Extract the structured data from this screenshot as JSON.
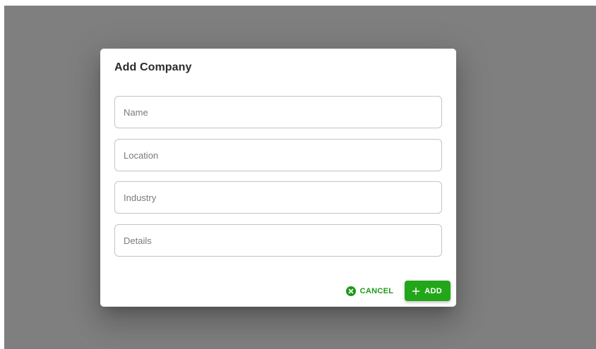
{
  "dialog": {
    "title": "Add Company",
    "fields": [
      {
        "placeholder": "Name",
        "value": ""
      },
      {
        "placeholder": "Location",
        "value": ""
      },
      {
        "placeholder": "Industry",
        "value": ""
      },
      {
        "placeholder": "Details",
        "value": ""
      }
    ],
    "actions": {
      "cancel_label": "CANCEL",
      "cancel_icon": "cancel-circle-icon",
      "add_label": "ADD",
      "add_icon": "plus-icon"
    }
  },
  "colors": {
    "accent": "#22a61a",
    "backdrop": "#7f7f7f"
  }
}
